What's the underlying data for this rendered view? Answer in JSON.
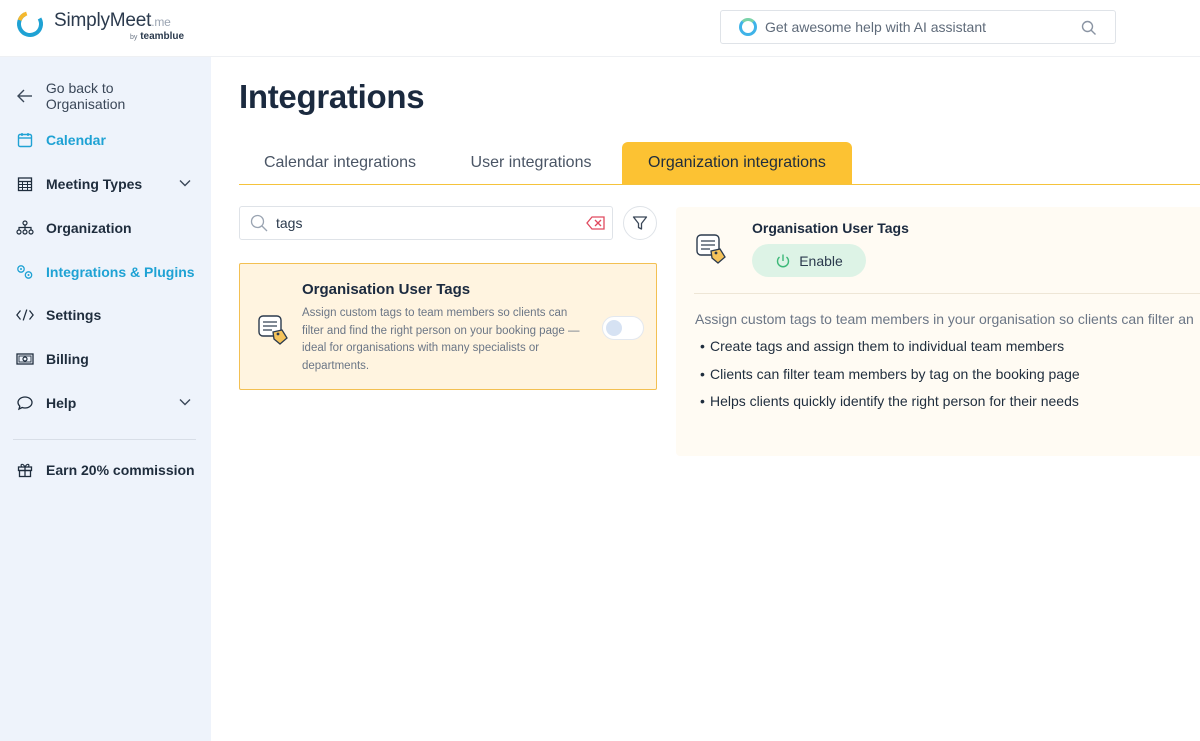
{
  "header": {
    "logo_name": "SimplyMeet",
    "logo_suffix": ".me",
    "logo_by": "by",
    "logo_brand": "teamblue",
    "ai_search_placeholder": "Get awesome help with AI assistant"
  },
  "sidebar": {
    "back_label": "Go back to Organisation",
    "items": [
      {
        "label": "Calendar",
        "icon": "calendar-icon"
      },
      {
        "label": "Meeting Types",
        "icon": "grid-calendar-icon"
      },
      {
        "label": "Organization",
        "icon": "org-chart-icon"
      },
      {
        "label": "Integrations & Plugins",
        "icon": "integrations-icon"
      },
      {
        "label": "Settings",
        "icon": "code-icon"
      },
      {
        "label": "Billing",
        "icon": "billing-icon"
      },
      {
        "label": "Help",
        "icon": "chat-bubble-icon"
      }
    ],
    "commission_label": "Earn 20% commission",
    "active_color": "#1fa2d4"
  },
  "main": {
    "title": "Integrations",
    "tabs": [
      {
        "label": "Calendar integrations",
        "active": false
      },
      {
        "label": "User integrations",
        "active": false
      },
      {
        "label": "Organization integrations",
        "active": true
      }
    ],
    "search": {
      "value": "tags"
    },
    "card": {
      "title": "Organisation User Tags",
      "description": "Assign custom tags to team members so clients can filter and find the right person on your booking page — ideal for organisations with many specialists or departments.",
      "toggle_on": false
    },
    "detail": {
      "title": "Organisation User Tags",
      "enable_label": "Enable",
      "description": "Assign custom tags to team members in your organisation so clients can filter an",
      "bullets": [
        "Create tags and assign them to individual team members",
        "Clients can filter team members by tag on the booking page",
        "Helps clients quickly identify the right person for their needs"
      ]
    }
  },
  "colors": {
    "tab_active": "#fcc233",
    "card_bg": "#fff4e0",
    "enable_bg": "#ddf3e6"
  }
}
